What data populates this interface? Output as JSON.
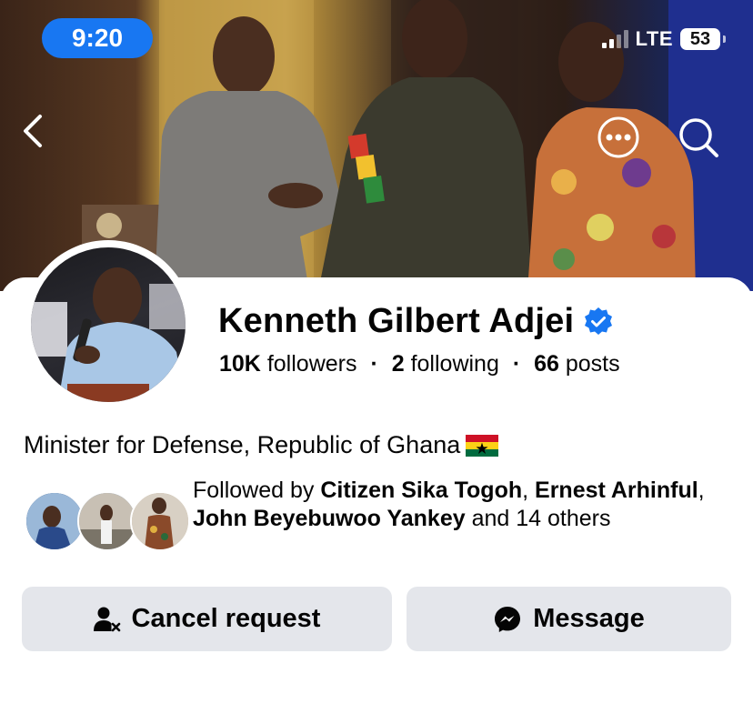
{
  "status_bar": {
    "time": "9:20",
    "network": "LTE",
    "battery": "53"
  },
  "header": {
    "back_icon": "chevron-left-icon",
    "more_icon": "more-horizontal-icon",
    "search_icon": "search-icon"
  },
  "profile": {
    "name": "Kenneth Gilbert Adjei",
    "verified_icon": "verified-badge-icon",
    "followers_count": "10K",
    "followers_label": "followers",
    "following_count": "2",
    "following_label": "following",
    "posts_count": "66",
    "posts_label": "posts",
    "bio": "Minister for Defense, Republic of Ghana"
  },
  "followed_by": {
    "prefix": "Followed by ",
    "names": [
      "Citizen Sika Togoh",
      "Ernest Arhinful",
      "John Beyebuwoo Yankey"
    ],
    "sep1": ", ",
    "sep2": ", ",
    "suffix": " and 14 others"
  },
  "actions": {
    "cancel_request_label": "Cancel request",
    "message_label": "Message"
  },
  "colors": {
    "accent": "#1877f2",
    "button_bg": "#e4e6eb",
    "text": "#050505"
  }
}
